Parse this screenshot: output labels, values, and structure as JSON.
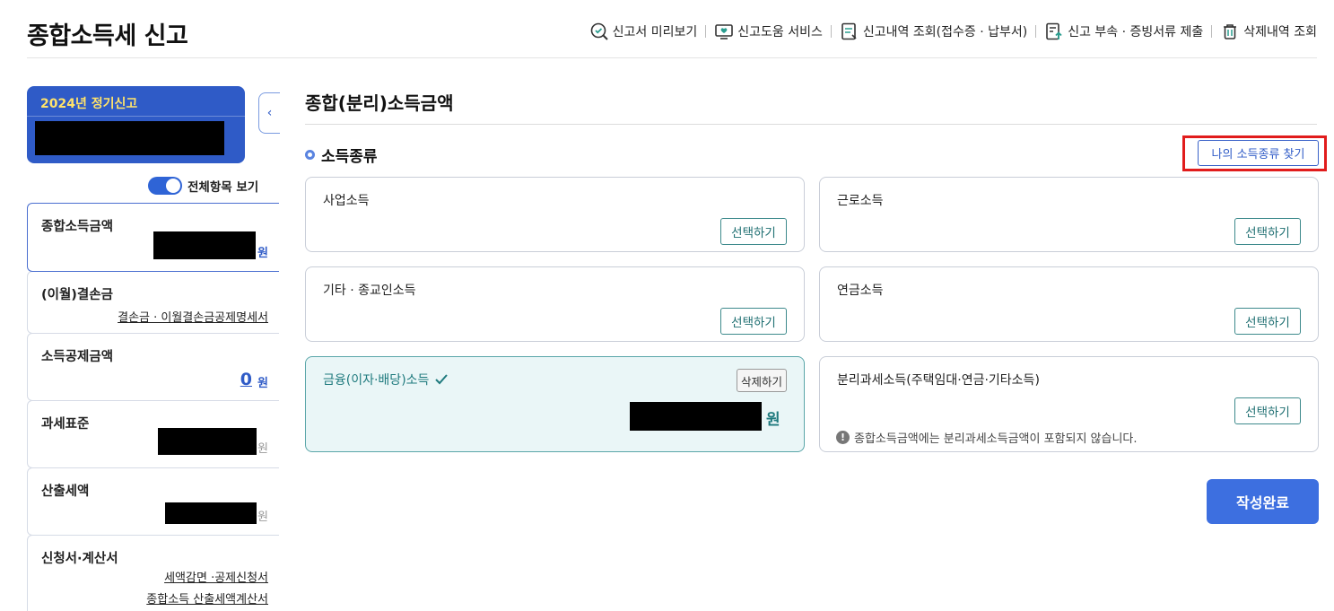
{
  "header": {
    "title": "종합소득세 신고",
    "nav": [
      {
        "label": "신고서 미리보기",
        "icon": "magnifier-check-icon"
      },
      {
        "label": "신고도움 서비스",
        "icon": "monitor-heart-icon"
      },
      {
        "label": "신고내역 조회(접수증 · 납부서)",
        "icon": "document-list-icon"
      },
      {
        "label": "신고 부속 · 증빙서류 제출",
        "icon": "document-upload-icon"
      },
      {
        "label": "삭제내역 조회",
        "icon": "trash-icon"
      }
    ]
  },
  "sidebar": {
    "year_title": "2024년 정기신고",
    "toggle_label": "전체항목 보기",
    "toggle_on": true,
    "items": [
      {
        "label": "종합소득금액",
        "unit": "원"
      },
      {
        "label": "(이월)결손금",
        "link": "결손금 · 이월결손금공제명세서"
      },
      {
        "label": "소득공제금액",
        "value": "0",
        "unit": "원"
      },
      {
        "label": "과세표준",
        "unit": "원"
      },
      {
        "label": "산출세액",
        "unit": "원"
      },
      {
        "label": "신청서·계산서",
        "links": [
          "세액감면 ·공제신청서",
          "종합소득 산출세액계산서"
        ]
      }
    ]
  },
  "main": {
    "section_title": "종합(분리)소득금액",
    "sub_title": "소득종류",
    "find_button": "나의 소득종류 찾기",
    "select_label": "선택하기",
    "delete_label": "삭제하기",
    "won": "원",
    "cards": [
      {
        "label": "사업소득"
      },
      {
        "label": "근로소득"
      },
      {
        "label": "기타 · 종교인소득"
      },
      {
        "label": "연금소득"
      },
      {
        "label": "금융(이자·배당)소득",
        "selected": true
      },
      {
        "label": "분리과세소득(주택임대·연금·기타소득)",
        "notice": "종합소득금액에는 분리과세소득금액이 포함되지 않습니다."
      }
    ],
    "done_button": "작성완료"
  },
  "colors": {
    "primary": "#2f5bc7",
    "accent_yellow": "#ffe36b",
    "teal": "#1f7a7e",
    "highlight_red": "#e11c1c"
  }
}
